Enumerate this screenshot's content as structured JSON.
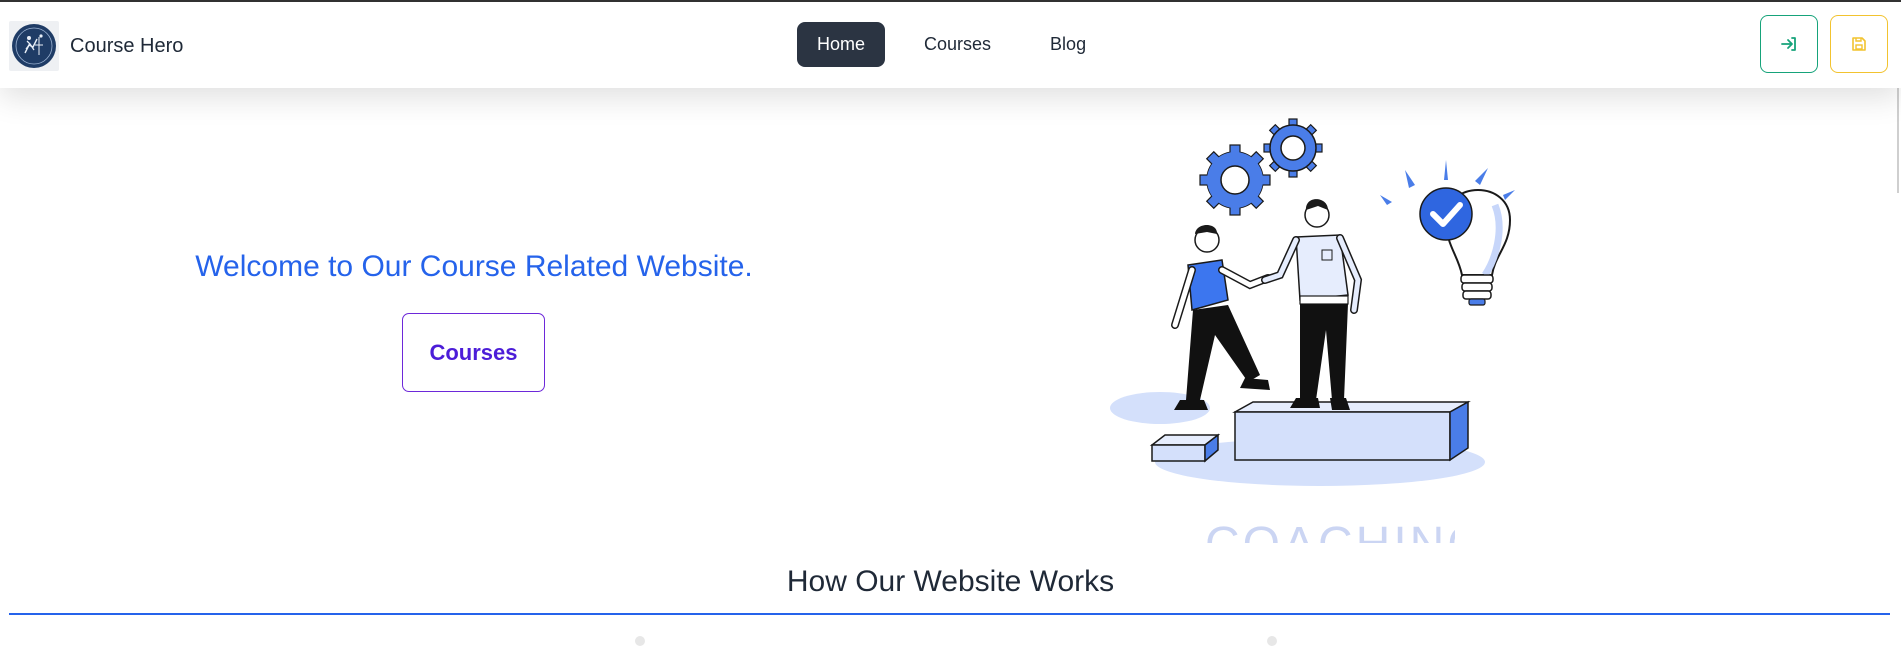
{
  "brand": {
    "name": "Course Hero",
    "logo_icon": "runner-logo-icon"
  },
  "nav": {
    "items": [
      {
        "label": "Home",
        "active": true
      },
      {
        "label": "Courses",
        "active": false
      },
      {
        "label": "Blog",
        "active": false
      }
    ]
  },
  "actions": {
    "login_icon": "sign-in-icon",
    "save_icon": "floppy-disk-icon"
  },
  "hero": {
    "title": "Welcome to Our Course Related Website.",
    "button_label": "Courses",
    "illustration_caption": "COACHING"
  },
  "section": {
    "title": "How Our Website Works"
  },
  "colors": {
    "brand_blue": "#2563eb",
    "nav_active_bg": "#2b3442",
    "button_purple": "#4c1dd8",
    "login_green": "#16a37a",
    "save_yellow": "#f2c32f",
    "illustration_light": "#d4e0fb"
  }
}
